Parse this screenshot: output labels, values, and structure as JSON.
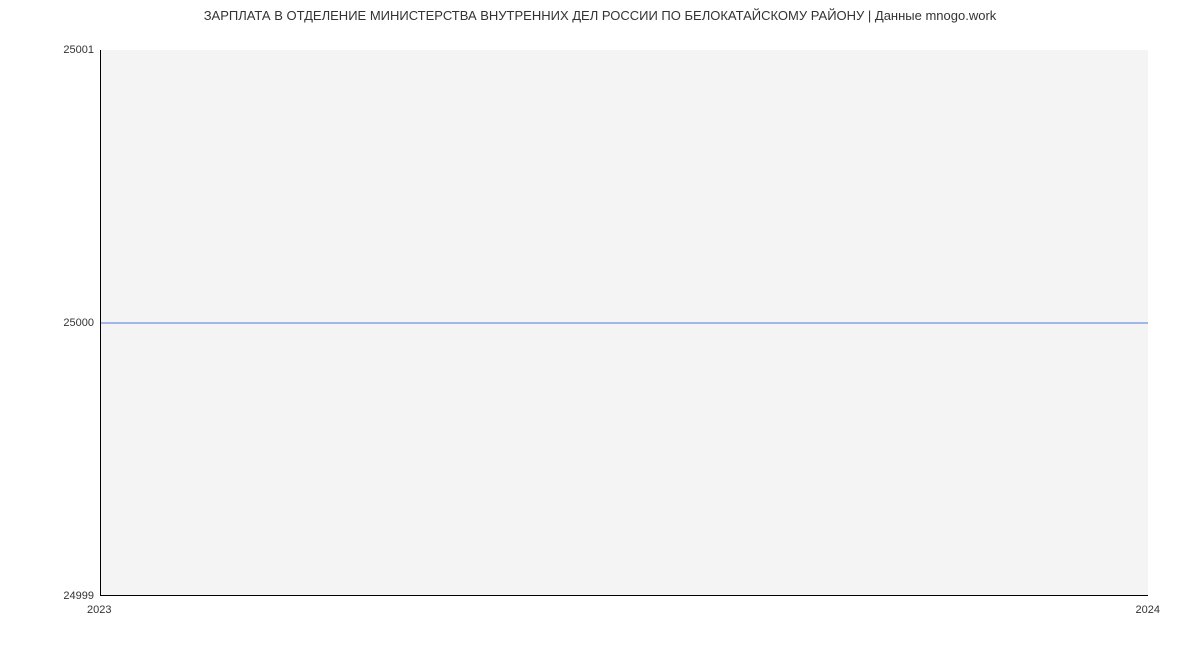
{
  "chart_data": {
    "type": "line",
    "title": "ЗАРПЛАТА В ОТДЕЛЕНИЕ МИНИСТЕРСТВА ВНУТРЕННИХ ДЕЛ РОССИИ ПО БЕЛОКАТАЙСКОМУ РАЙОНУ | Данные mnogo.work",
    "x": [
      "2023",
      "2024"
    ],
    "values": [
      25000,
      25000
    ],
    "xlabel": "",
    "ylabel": "",
    "yticks": [
      24999,
      25000,
      25001
    ],
    "xticks": [
      "2023",
      "2024"
    ],
    "ylim": [
      24999,
      25001
    ],
    "line_color": "#4a7dda"
  }
}
